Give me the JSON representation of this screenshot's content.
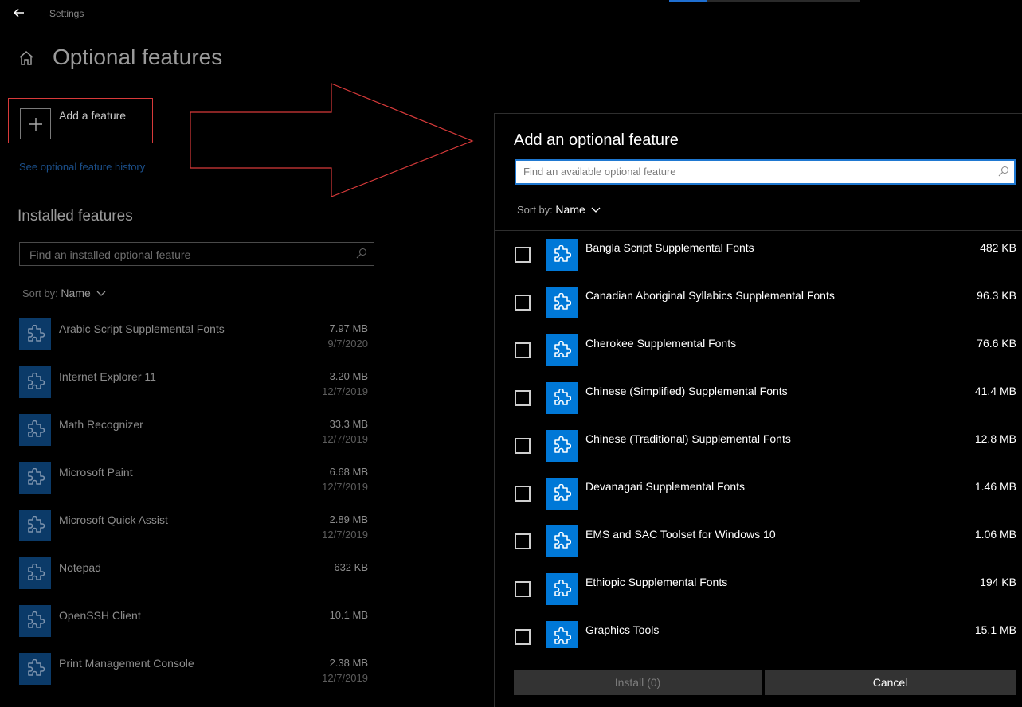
{
  "window": {
    "title": "Settings"
  },
  "page": {
    "title": "Optional features",
    "add_feature_label": "Add a feature",
    "history_link": "See optional feature history",
    "installed_heading": "Installed features",
    "installed_search_placeholder": "Find an installed optional feature",
    "sort_label": "Sort by:",
    "sort_value": "Name"
  },
  "installed": [
    {
      "name": "Arabic Script Supplemental Fonts",
      "size": "7.97 MB",
      "date": "9/7/2020"
    },
    {
      "name": "Internet Explorer 11",
      "size": "3.20 MB",
      "date": "12/7/2019"
    },
    {
      "name": "Math Recognizer",
      "size": "33.3 MB",
      "date": "12/7/2019"
    },
    {
      "name": "Microsoft Paint",
      "size": "6.68 MB",
      "date": "12/7/2019"
    },
    {
      "name": "Microsoft Quick Assist",
      "size": "2.89 MB",
      "date": "12/7/2019"
    },
    {
      "name": "Notepad",
      "size": "632 KB",
      "date": ""
    },
    {
      "name": "OpenSSH Client",
      "size": "10.1 MB",
      "date": ""
    },
    {
      "name": "Print Management Console",
      "size": "2.38 MB",
      "date": "12/7/2019"
    }
  ],
  "panel": {
    "title": "Add an optional feature",
    "search_placeholder": "Find an available optional feature",
    "sort_label": "Sort by:",
    "sort_value": "Name",
    "install_button": "Install (0)",
    "cancel_button": "Cancel"
  },
  "available": [
    {
      "name": "Bangla Script Supplemental Fonts",
      "size": "482 KB"
    },
    {
      "name": "Canadian Aboriginal Syllabics Supplemental Fonts",
      "size": "96.3 KB"
    },
    {
      "name": "Cherokee Supplemental Fonts",
      "size": "76.6 KB"
    },
    {
      "name": "Chinese (Simplified) Supplemental Fonts",
      "size": "41.4 MB"
    },
    {
      "name": "Chinese (Traditional) Supplemental Fonts",
      "size": "12.8 MB"
    },
    {
      "name": "Devanagari Supplemental Fonts",
      "size": "1.46 MB"
    },
    {
      "name": "EMS and SAC Toolset for Windows 10",
      "size": "1.06 MB"
    },
    {
      "name": "Ethiopic Supplemental Fonts",
      "size": "194 KB"
    },
    {
      "name": "Graphics Tools",
      "size": "15.1 MB"
    }
  ],
  "colors": {
    "accent": "#0078d7",
    "annotation_red": "#d83a3a",
    "installed_icon_bg": "#0b3a68"
  },
  "icons": {
    "back": "back-arrow-icon",
    "home": "home-icon",
    "add": "plus-icon",
    "search": "search-icon",
    "feature": "puzzle-icon",
    "sort": "chevron-down-icon"
  },
  "progress": {
    "value_fraction": 0.2
  }
}
